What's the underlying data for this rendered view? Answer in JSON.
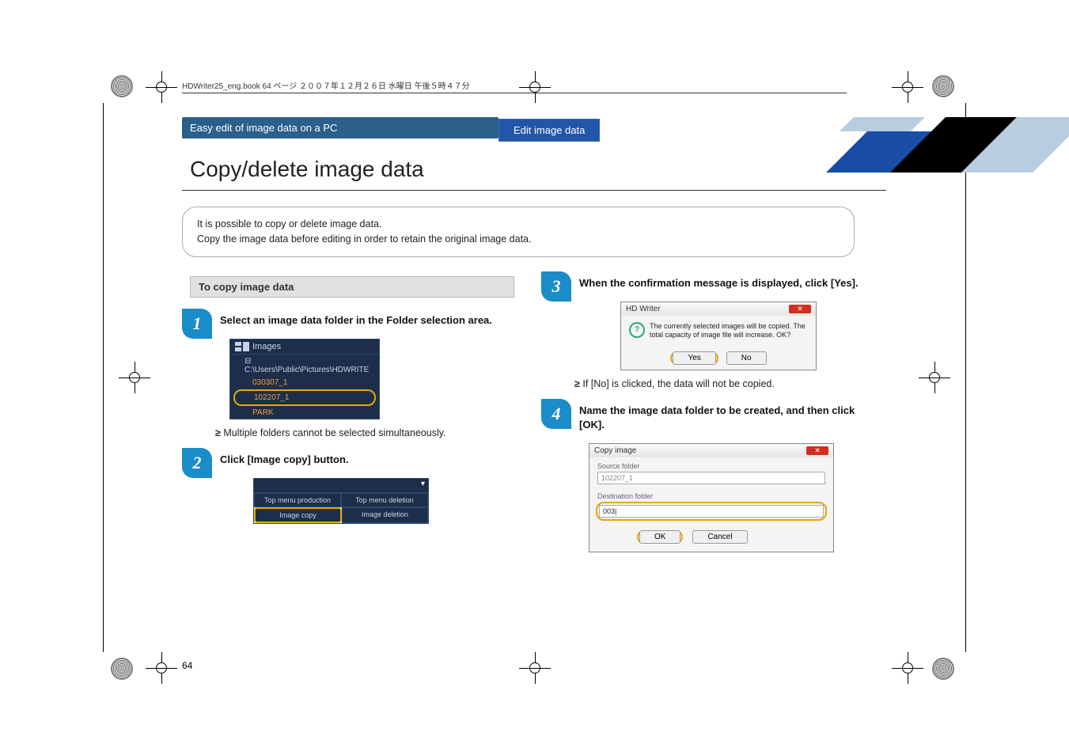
{
  "header_line": "HDWriter25_eng.book  64 ページ  ２００７年１２月２６日  水曜日  午後５時４７分",
  "breadcrumb": {
    "left": "Easy edit of image data on a PC",
    "right": "Edit image data"
  },
  "title": "Copy/delete image data",
  "intro": {
    "l1": "It is possible to copy or delete image data.",
    "l2": "Copy the image data before editing in order to retain the original image data."
  },
  "section_head": "To copy image data",
  "steps": {
    "s1": {
      "num": "1",
      "text": "Select an image data folder in the Folder selection area."
    },
    "s2": {
      "num": "2",
      "text": "Click [Image copy] button."
    },
    "s3": {
      "num": "3",
      "text": "When the confirmation message is displayed, click [Yes]."
    },
    "s4": {
      "num": "4",
      "text": "Name the image data folder to be created, and then click [OK]."
    }
  },
  "folder_panel": {
    "header": "Images",
    "path": "⊟ C:\\Users\\Public\\Pictures\\HDWRITE",
    "items": [
      "030307_1",
      "102207_1",
      "PARK"
    ]
  },
  "note1": "Multiple folders cannot be selected simultaneously.",
  "btnbar": {
    "r1c1": "Top menu production",
    "r1c2": "Top menu deletion",
    "r2c1": "Image copy",
    "r2c2": "Image deletion"
  },
  "dlg1": {
    "title": "HD Writer",
    "msg": "The currently selected images will be copied. The total capacity of image file will increase. OK?",
    "yes": "Yes",
    "no": "No"
  },
  "note2": "If [No] is clicked, the data will not be copied.",
  "dlg2": {
    "title": "Copy image",
    "lbl_src": "Source folder",
    "val_src": "102207_1",
    "lbl_dst": "Destination folder",
    "val_dst": "003|",
    "ok": "OK",
    "cancel": "Cancel"
  },
  "page_num": "64"
}
